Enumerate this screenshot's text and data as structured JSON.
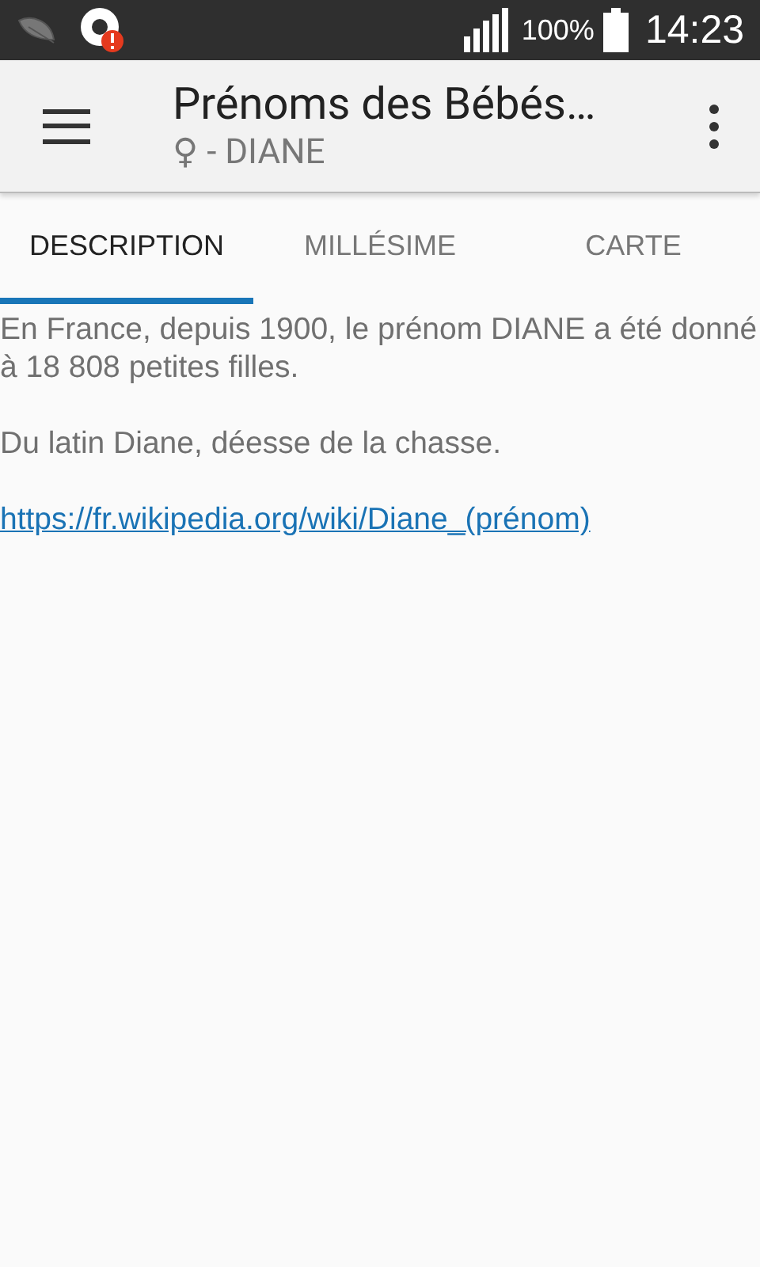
{
  "status_bar": {
    "battery": "100%",
    "time": "14:23"
  },
  "app_bar": {
    "title": "Prénoms des Bébés…",
    "subtitle": "♀ - DIANE"
  },
  "tabs": [
    {
      "label": "DESCRIPTION",
      "selected": true
    },
    {
      "label": "MILLÉSIME",
      "selected": false
    },
    {
      "label": "CARTE",
      "selected": false
    }
  ],
  "content": {
    "paragraphs": [
      "En France, depuis 1900, le prénom DIANE a été donné à 18 808 petites filles.",
      "Du latin Diane, déesse de la chasse."
    ],
    "link": "https://fr.wikipedia.org/wiki/Diane_(prénom)"
  }
}
